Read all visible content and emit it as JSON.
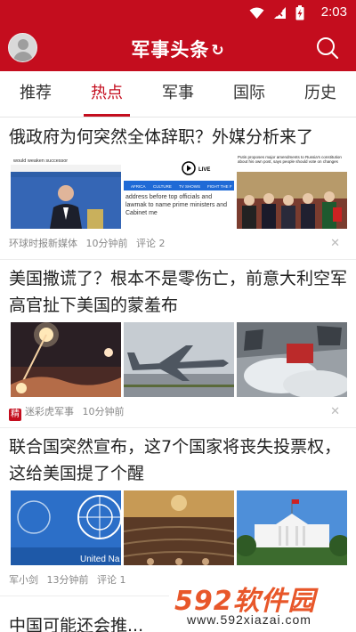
{
  "status_bar": {
    "time": "2:03"
  },
  "app_bar": {
    "title": "军事头条",
    "refresh_glyph": "↻"
  },
  "tabs": [
    {
      "label": "推荐",
      "active": false
    },
    {
      "label": "热点",
      "active": true
    },
    {
      "label": "军事",
      "active": false
    },
    {
      "label": "国际",
      "active": false
    },
    {
      "label": "历史",
      "active": false
    }
  ],
  "articles": [
    {
      "headline": "俄政府为何突然全体辞职？外媒分析来了",
      "source": "环球时报新媒体",
      "time": "10分钟前",
      "comments": "评论 2",
      "thumb_text": {
        "a_caption": "would weaken successor",
        "b_live": "LIVE",
        "b_nav": [
          "AFRICA",
          "CULTURE",
          "TV SHOWS",
          "FIGHT THE F"
        ],
        "b_body": "address before top officials and lawmak to name prime ministers and Cabinet me",
        "c_caption": "Putin proposes major amendments to Russia's constitution about his own post, says people should vote on changes"
      }
    },
    {
      "headline": "美国撒谎了？根本不是零伤亡，前意大利空军高官扯下美国的蒙羞布",
      "badge": "精",
      "source": "迷彩虎军事",
      "time": "10分钟前",
      "comments": ""
    },
    {
      "headline": "联合国突然宣布，这7个国家将丧失投票权，这给美国提了个醒",
      "source": "军小剑",
      "time": "13分钟前",
      "comments": "评论 1",
      "thumb_text": {
        "a_caption": "United Na"
      }
    }
  ],
  "partial_headline": "中国可能还会推...",
  "watermark": {
    "brand": "592软件园",
    "url": "www.592xiazai.com"
  },
  "colors": {
    "brand_red": "#c40d1e",
    "watermark_orange": "#e8572a",
    "watermark_blue": "#1b8fd6"
  }
}
